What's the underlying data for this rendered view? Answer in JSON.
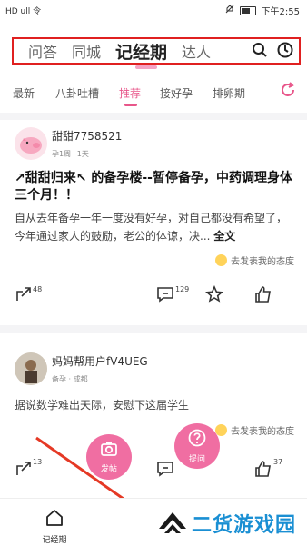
{
  "status_bar": {
    "left": "HD ull 令",
    "time": "下午2:55"
  },
  "top_tabs": [
    {
      "label": "问答"
    },
    {
      "label": "同城"
    },
    {
      "label": "记经期",
      "active": true
    },
    {
      "label": "达人"
    }
  ],
  "sub_tabs": [
    {
      "label": "最新"
    },
    {
      "label": "八卦吐槽"
    },
    {
      "label": "推荐",
      "active": true
    },
    {
      "label": "接好孕"
    },
    {
      "label": "排卵期"
    }
  ],
  "posts": [
    {
      "user": "甜甜7758521",
      "meta": "孕1周+1天",
      "title": "↗甜甜归来↖ 的备孕楼--暂停备孕，中药调理身体三个月！！",
      "body": "自从去年备孕一年一度没有好孕，对自己都没有希望了，今年通过家人的鼓励，老公的体谅，决...",
      "full_text_label": "全文",
      "attitude": "去发表我的态度",
      "share_count": "48",
      "comment_count": "129"
    },
    {
      "user": "妈妈帮用户fV4UEG",
      "meta": "备孕 · 成都",
      "body": "据说数学难出天际，安慰下这届学生",
      "attitude": "去发表我的态度",
      "share_count": "13",
      "like_count": "37"
    }
  ],
  "fabs": {
    "post_label": "发帖",
    "ask_label": "提问"
  },
  "bottom_nav": {
    "label": "记经期"
  },
  "watermark": {
    "text": "二货游戏园"
  },
  "colors": {
    "accent": "#e8568a",
    "fab": "#f06ea2",
    "highlight_box": "#e02020",
    "watermark": "#1a8fd3"
  }
}
